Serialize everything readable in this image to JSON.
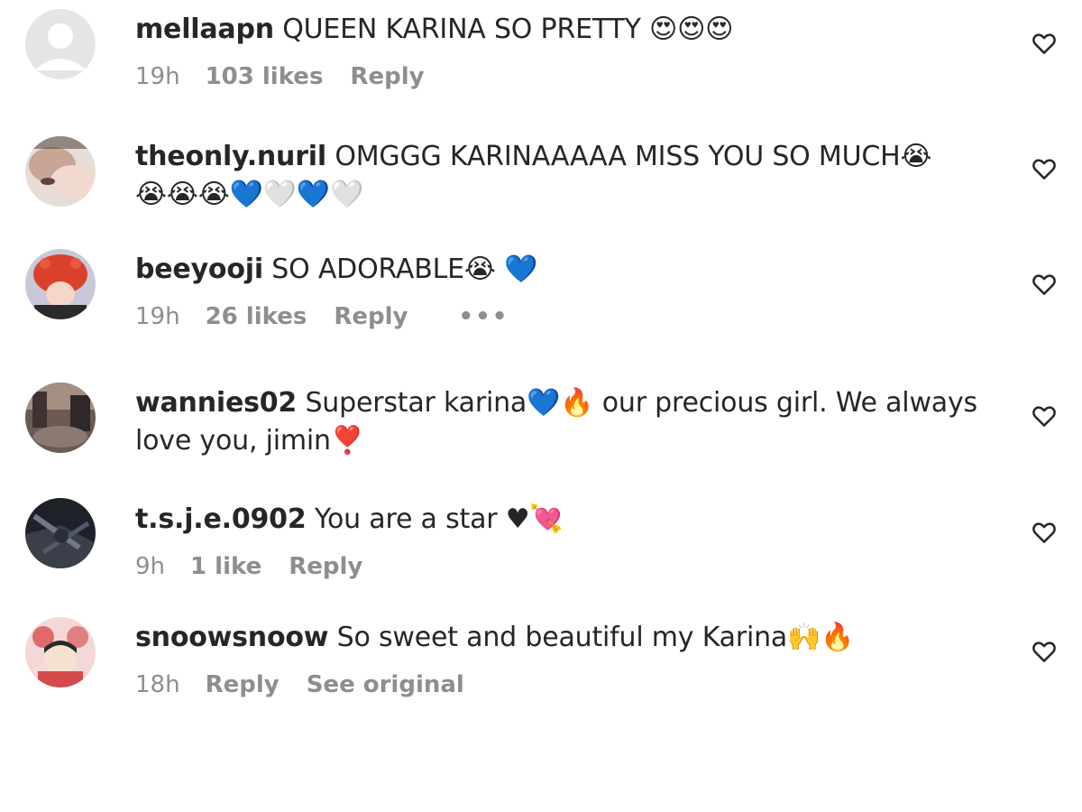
{
  "comments": [
    {
      "username": "mellaapn",
      "text": "QUEEN KARINA SO PRETTY 😍😍😍",
      "time": "19h",
      "likes": "103 likes",
      "reply": "Reply"
    },
    {
      "username": "theonly.nuril",
      "text": "OMGGG KARINAAAAA MISS YOU SO MUCH😭",
      "text2": "😭😭😭💙🤍💙🤍"
    },
    {
      "username": "beeyooji",
      "text": "SO ADORABLE😭 💙",
      "time": "19h",
      "likes": "26 likes",
      "reply": "Reply",
      "more": "•••"
    },
    {
      "username": "wannies02",
      "text": "Superstar karina💙🔥 our precious girl. We always",
      "text2": "love you, jimin❣️"
    },
    {
      "username": "t.s.j.e.0902",
      "text": "You are a star ♥💘",
      "time": "9h",
      "likes": "1 like",
      "reply": "Reply"
    },
    {
      "username": "snoowsnoow",
      "text": "So sweet and beautiful my Karina🙌🔥",
      "time": "18h",
      "reply": "Reply",
      "see_original": "See original"
    }
  ],
  "icons": {
    "like": "heart-outline-icon",
    "placeholder_avatar": "default-avatar-icon"
  },
  "colors": {
    "text": "#262626",
    "secondary": "#8e8e8e",
    "placeholder_avatar_bg": "#dbdbdb"
  }
}
